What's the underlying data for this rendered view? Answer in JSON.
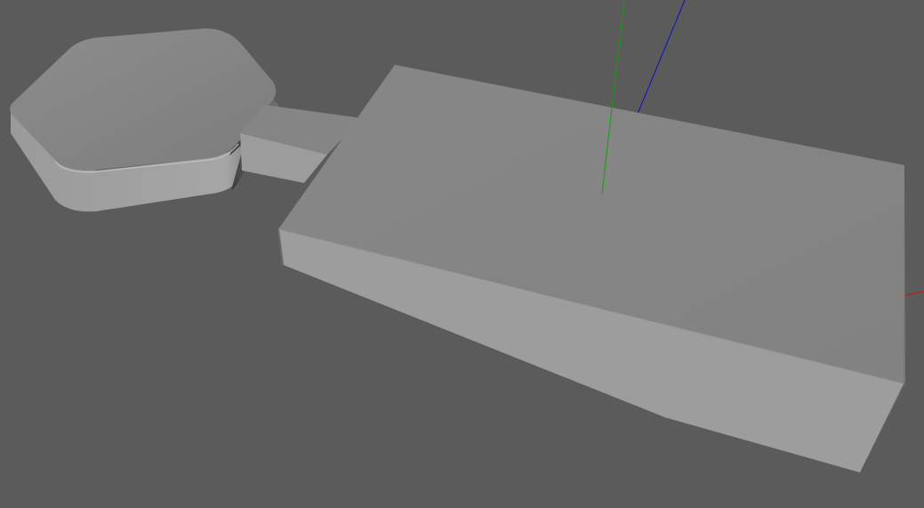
{
  "viewport": {
    "background_color": "#5b5b5b",
    "shading": {
      "top_face": "#858585",
      "front_face": "#9d9d9d",
      "side_face": "#6e6e6e",
      "edge_highlight": "#a8a8a8",
      "shadow": "#3c3c3c"
    },
    "axes": {
      "x_axis_color": "#d01010",
      "y_axis_color": "#10a010",
      "z_axis_color": "#1010c0"
    },
    "objects": [
      {
        "name": "hexagon-disc"
      },
      {
        "name": "connector-bar"
      },
      {
        "name": "wedge-block"
      }
    ]
  }
}
